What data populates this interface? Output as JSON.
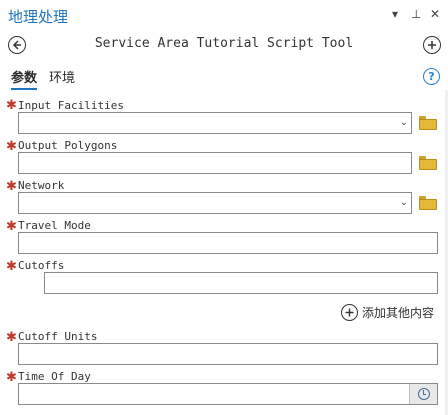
{
  "pane": {
    "title": "地理处理",
    "controls": {
      "menu": "▾",
      "pin": "⊥",
      "close": "✕"
    }
  },
  "tool": {
    "back_icon": "back-arrow-icon",
    "title": "Service Area Tutorial Script Tool",
    "add_icon": "plus-icon"
  },
  "tabs": [
    {
      "label": "参数",
      "active": true
    },
    {
      "label": "环境",
      "active": false
    }
  ],
  "help": {
    "glyph": "?"
  },
  "params": {
    "input_facilities": {
      "label": "Input Facilities",
      "required": true,
      "value": "",
      "type": "dropdown+browse"
    },
    "output_polygons": {
      "label": "Output Polygons",
      "required": true,
      "value": "",
      "type": "text+browse"
    },
    "network": {
      "label": "Network",
      "required": true,
      "value": "",
      "type": "dropdown+browse"
    },
    "travel_mode": {
      "label": "Travel Mode",
      "required": true,
      "value": "",
      "type": "text"
    },
    "cutoffs": {
      "label": "Cutoffs",
      "required": true,
      "value": "",
      "type": "multivalue"
    },
    "cutoff_units": {
      "label": "Cutoff Units",
      "required": true,
      "value": "",
      "type": "text"
    },
    "time_of_day": {
      "label": "Time Of Day",
      "required": true,
      "value": "",
      "type": "datetime"
    }
  },
  "add_more": {
    "label": "添加其他内容"
  },
  "colors": {
    "accent": "#1f75be",
    "required": "#c0392b",
    "folder": "#e2b93b"
  }
}
